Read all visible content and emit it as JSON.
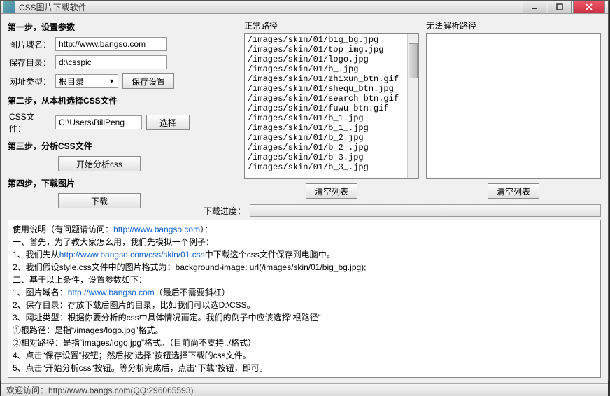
{
  "window": {
    "title": "CSS图片下载软件"
  },
  "steps": {
    "s1": {
      "title": "第一步，设置参数",
      "domain_label": "图片域名：",
      "domain_value": "http://www.bangso.com",
      "dir_label": "保存目录：",
      "dir_value": "d:\\csspic",
      "type_label": "网址类型：",
      "type_value": "根目录",
      "save_btn": "保存设置"
    },
    "s2": {
      "title": "第二步，从本机选择CSS文件",
      "file_label": "CSS文件：",
      "file_value": "C:\\Users\\BillPeng",
      "select_btn": "选择"
    },
    "s3": {
      "title": "第三步，分析CSS文件",
      "analyze_btn": "开始分析css"
    },
    "s4": {
      "title": "第四步，下载图片",
      "download_btn": "下载"
    }
  },
  "lists": {
    "ok_title": "正常路径",
    "bad_title": "无法解析路径",
    "clear_btn": "清空列表",
    "ok_items": [
      "/images/skin/01/big_bg.jpg",
      "/images/skin/01/top_img.jpg",
      "/images/skin/01/logo.jpg",
      "/images/skin/01/b_.jpg",
      "/images/skin/01/zhixun_btn.gif",
      "/images/skin/01/shequ_btn.jpg",
      "/images/skin/01/search_btn.gif",
      "/images/skin/01/fuwu_btn.gif",
      "/images/skin/01/b_1.jpg",
      "/images/skin/01/b_1_.jpg",
      "/images/skin/01/b_2.jpg",
      "/images/skin/01/b_2_.jpg",
      "/images/skin/01/b_3.jpg",
      "/images/skin/01/b_3_.jpg"
    ]
  },
  "progress": {
    "label": "下载进度："
  },
  "help": {
    "l0_a": "使用说明（有问题请访问：",
    "l0_link": "http://www.bangso.com",
    "l0_b": "）：",
    "l1": "一、首先，为了教大家怎么用，我们先模拟一个例子：",
    "l2_a": "1、我们先从",
    "l2_link": "http://www.bangso.com/css/skin/01.css",
    "l2_b": "中下载这个css文件保存到电脑中。",
    "l3": "2、我们假设style.css文件中的图片格式为：background-image: url(/images/skin/01/big_bg.jpg);",
    "l4": "二、基于以上条件，设置参数如下：",
    "l5_a": "1、图片域名：",
    "l5_link": "http://www.bangso.com",
    "l5_b": "（最后不需要斜杠）",
    "l6": "2、保存目录：存放下载后图片的目录，比如我们可以选D:\\CSS。",
    "l7": "3、网址类型：根据你要分析的css中具体情况而定。我们的例子中应该选择“根路径”",
    "l8": "①根路径：是指“/images/logo.jpg”格式。",
    "l9": "②相对路径：是指“images/logo.jpg”格式。（目前尚不支持../格式）",
    "l10": "4、点击“保存设置”按钮；然后按“选择”按钮选择下载的css文件。",
    "l11": "5、点击“开始分析css”按钮。等分析完成后，点击“下载”按钮，即可。"
  },
  "status": "欢迎访问：http://www.bangs.com(QQ:296065593)"
}
